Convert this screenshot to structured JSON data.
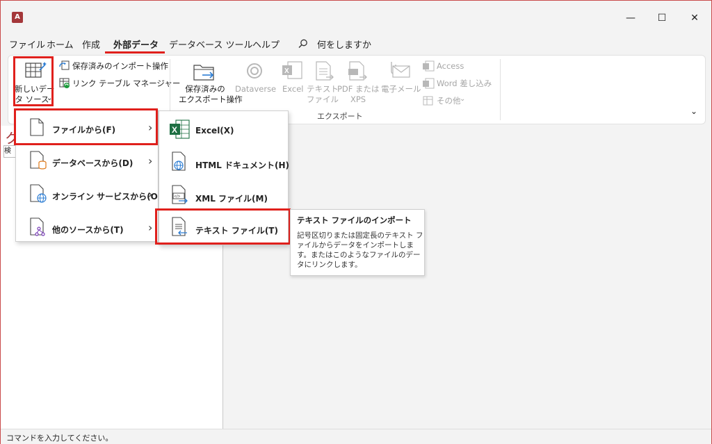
{
  "window": {
    "app_icon_letter": "A",
    "controls": {
      "minimize": "—",
      "maximize": "☐",
      "close": "✕"
    }
  },
  "menu": {
    "items": [
      "ファイル",
      "ホーム",
      "作成",
      "外部データ",
      "データベース ツール",
      "ヘルプ"
    ],
    "active": "外部データ",
    "search_label": "何をしますか"
  },
  "ribbon": {
    "new_data_source": {
      "line1": "新しいデー",
      "line2": "タ ソース",
      "chevron": "⌄"
    },
    "saved_imports": "保存済みのインポート操作",
    "linked_table_manager": "リンク テーブル マネージャー",
    "saved_exports": {
      "line1": "保存済みの",
      "line2": "エクスポート操作"
    },
    "dataverse": "Dataverse",
    "excel": "Excel",
    "text_file": {
      "line1": "テキスト",
      "line2": "ファイル"
    },
    "pdf_xps": {
      "line1": "PDF または",
      "line2": "XPS"
    },
    "email": "電子メール",
    "access": "Access",
    "word_merge": "Word 差し込み",
    "more": "その他",
    "export_group_label": "エクスポート",
    "collapse": "⌄"
  },
  "left_pane": {
    "title_partial": "ク",
    "search_partial": "検索"
  },
  "dropdown_sources": {
    "items": [
      {
        "label": "ファイルから(F)",
        "icon": "file-icon"
      },
      {
        "label": "データベースから(D)",
        "icon": "database-icon"
      },
      {
        "label": "オンライン サービスから(O)",
        "icon": "online-service-icon"
      },
      {
        "label": "他のソースから(T)",
        "icon": "other-sources-icon"
      }
    ],
    "arrow": "›"
  },
  "dropdown_files": {
    "items": [
      {
        "label": "Excel(X)",
        "icon": "excel-icon"
      },
      {
        "label": "HTML ドキュメント(H)",
        "icon": "html-document-icon"
      },
      {
        "label": "XML ファイル(M)",
        "icon": "xml-file-icon"
      },
      {
        "label": "テキスト ファイル(T)",
        "icon": "text-file-icon"
      }
    ]
  },
  "tooltip": {
    "title": "テキスト ファイルのインポート",
    "body": "記号区切りまたは固定長のテキスト ファイルからデータをインポートします。またはこのようなファイルのデータにリンクします。"
  },
  "statusbar": {
    "text": "コマンドを入力してください。"
  },
  "colors": {
    "highlight_red": "#e0201c",
    "access_brand": "#a4373a",
    "excel_green": "#1d6f42",
    "link_blue": "#2b7cd3"
  }
}
